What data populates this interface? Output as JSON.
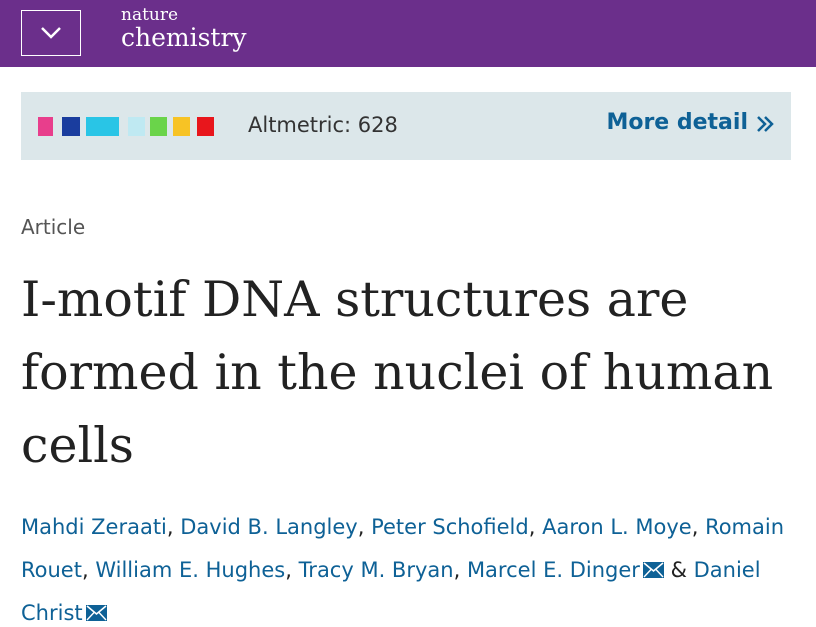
{
  "header": {
    "menu_icon": "chevron-down-icon",
    "logo_line1": "nature",
    "logo_line2": "chemistry",
    "bg_color": "#6b2f8b"
  },
  "altmetric": {
    "label": "Altmetric: 628",
    "more_label": "More detail",
    "more_icon": "double-chevron-right-icon",
    "colors": [
      "#e83e8c",
      "#1a3d9e",
      "#29c5e6",
      "#bfe9f2",
      "#6ad44a",
      "#f7c325",
      "#e8161c"
    ]
  },
  "article": {
    "type": "Article",
    "title": "I-motif DNA structures are formed in the nuclei of human cells"
  },
  "authors": [
    "Mahdi Zeraati",
    "David B. Langley",
    "Peter Schofield",
    "Aaron L. Moye",
    "Romain Rouet",
    "William E. Hughes",
    "Tracy M. Bryan",
    "Marcel E. Dinger",
    "Daniel Christ"
  ],
  "separators": {
    "comma": ", ",
    "ampersand": " & "
  }
}
